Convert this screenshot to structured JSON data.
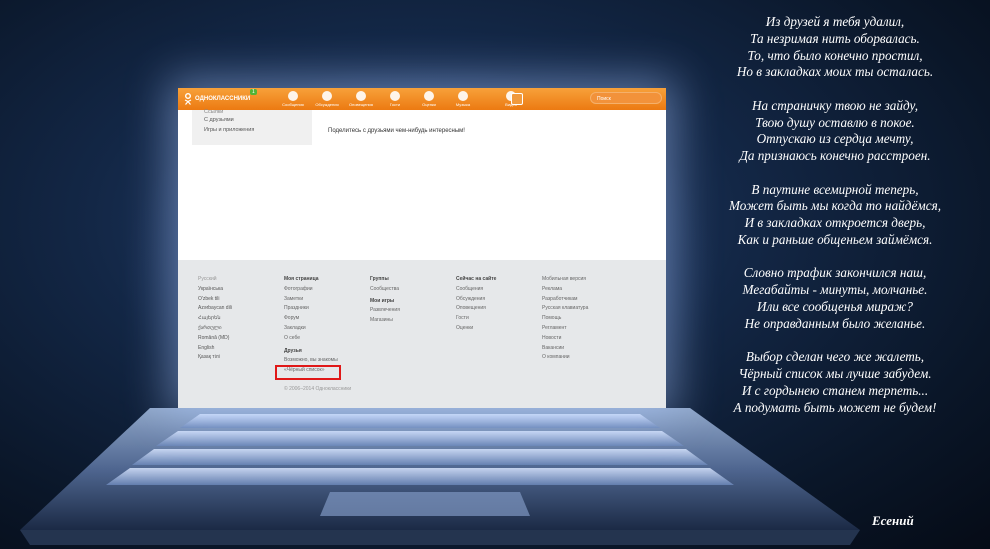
{
  "screen": {
    "logo": "ОДНОКЛАССНИКИ",
    "badge": "1",
    "nav": [
      "Сообщения",
      "Обсуждения",
      "Оповещения",
      "Гости",
      "Оценки",
      "Музыка",
      "Видео"
    ],
    "search_placeholder": "Поиск",
    "left_menu": [
      "Ссылки",
      "С друзьями",
      "Игры и приложения"
    ],
    "share_text": "Поделитесь с друзьями чем-нибудь интересным!",
    "footer": {
      "languages": [
        "Русский",
        "Українська",
        "O'zbek tili",
        "Azərbaycan dili",
        "Հայերեն",
        "ქართული",
        "Română (MD)",
        "English",
        "Қазақ тілі"
      ],
      "my_page": {
        "title": "Моя страница",
        "items": [
          "Фотографии",
          "Заметки",
          "Праздники",
          "Форум",
          "Закладки",
          "О себе"
        ]
      },
      "friends": {
        "title": "Друзья",
        "items": [
          "Возможно, вы знакомы",
          "«Чёрный список»"
        ]
      },
      "groups": {
        "title": "Группы",
        "items": [
          "Сообщества"
        ],
        "games_title": "Мои игры",
        "games_items": [
          "Развлечения",
          "Магазины"
        ]
      },
      "now_on_site": {
        "title": "Сейчас на сайте",
        "items": [
          "Сообщения",
          "Обсуждения",
          "Оповещения",
          "Гости",
          "Оценки"
        ]
      },
      "misc": [
        "Мобильная версия",
        "Реклама",
        "Разработчикам",
        "Русская клавиатура",
        "Помощь",
        "Регламент",
        "Новости",
        "Вакансии",
        "О компании"
      ],
      "copyright": "© 2006–2014 Одноклассники"
    }
  },
  "poem": {
    "stanzas": [
      [
        "Из друзей я тебя удалил,",
        "Та незримая нить оборвалась.",
        "То, что было конечно простил,",
        "Но в закладках моих ты осталась."
      ],
      [
        "На страничку твою не зайду,",
        "Твою душу оставлю в покое.",
        "Отпускаю из сердца мечту,",
        "Да признаюсь конечно расстроен."
      ],
      [
        "В паутине всемирной теперь,",
        "Может быть мы когда то найдёмся,",
        "И в закладках откроется дверь,",
        "Как и раньше общеньем займёмся."
      ],
      [
        "Словно трафик закончился наш,",
        "Мегабайты - минуты, молчанье.",
        "Или все сообщенья мираж?",
        "Не оправданным было желанье."
      ],
      [
        "Выбор сделан чего же жалеть,",
        "Чёрный список мы лучше забудем.",
        "И с гордынею станем терпеть...",
        "А подумать быть может не будем!"
      ]
    ],
    "author": "Есений"
  }
}
